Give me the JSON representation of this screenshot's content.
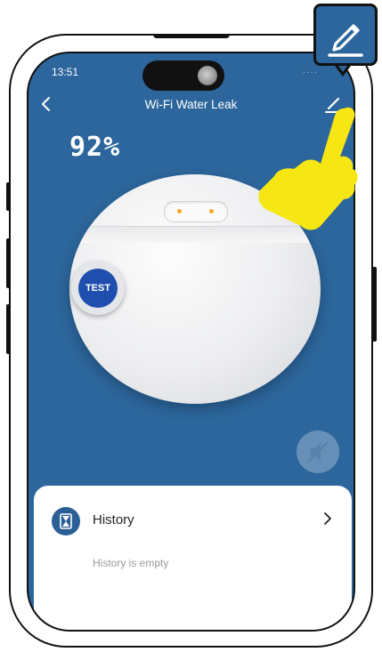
{
  "status_bar": {
    "time": "13:51"
  },
  "nav": {
    "title": "Wi-Fi Water Leak",
    "back_icon": "chevron-left-icon",
    "edit_icon": "pencil-icon"
  },
  "device": {
    "battery_text": "92%",
    "test_label": "TEST",
    "mute_icon": "speaker-mute-icon"
  },
  "history": {
    "label": "History",
    "empty_text": "History is empty",
    "icon": "hourglass-icon"
  },
  "colors": {
    "app_background": "#2c669c",
    "test_button": "#1f4fae",
    "card": "#ffffff",
    "hint_hand": "#f5e614"
  }
}
